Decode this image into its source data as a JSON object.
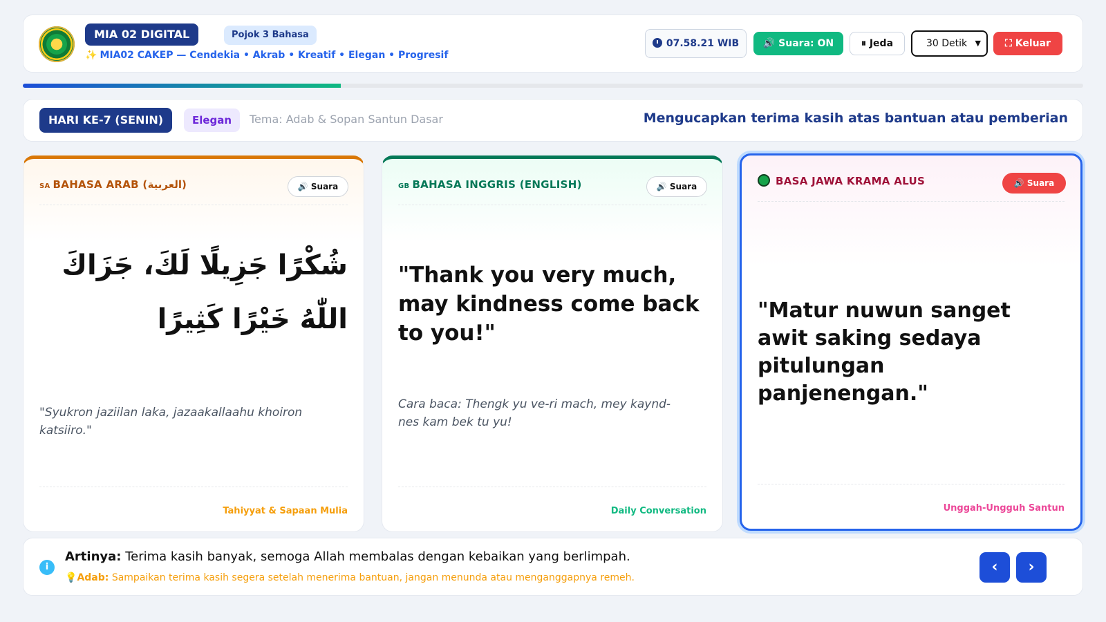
{
  "header": {
    "brand": "MIA 02 DIGITAL",
    "badge": "Pojok 3 Bahasa",
    "tagline": "MIA02 CAKEP — Cendekia • Akrab • Kreatif • Elegan • Progresif",
    "clock": "07.58.21 WIB",
    "sound_button": "🔊 Suara: ON",
    "pause_button": "⏸ Jeda",
    "interval_select": "30 Detik",
    "exit_button": "⛶ Keluar",
    "progress": 0.3
  },
  "topic": {
    "day": "HARI KE-7 (SENIN)",
    "value": "Elegan",
    "theme": "Tema: Adab & Sopan Santun Dasar",
    "headline": "Mengucapkan terima kasih atas bantuan atau pemberian"
  },
  "cards": {
    "arab": {
      "code": "SA",
      "title": "BAHASA ARAB (العربية)",
      "voice": "🔊 Suara",
      "phrase": "شُكْرًا جَزِيلًا لَكَ، جَزَاكَ اللّٰهُ خَيْرًا كَثِيرًا",
      "reading": "\"Syukron jaziilan laka, jazaakallaahu khoiron katsiiro.\"",
      "category": "Tahiyyat & Sapaan Mulia"
    },
    "english": {
      "code": "GB",
      "title": "BAHASA INGGRIS (ENGLISH)",
      "voice": "🔊 Suara",
      "phrase": "\"Thank you very much, may kindness come back to you!\"",
      "reading": "Cara baca: Thengk yu ve-ri mach, mey kaynd-nes kam bek tu yu!",
      "category": "Daily Conversation"
    },
    "jawa": {
      "title": "BASA JAWA KRAMA ALUS",
      "voice": "🔊 Suara",
      "phrase": "\"Matur nuwun sanget awit saking sedaya pitulungan panjenengan.\"",
      "category": "Unggah-Ungguh Santun"
    }
  },
  "footer": {
    "meaning_label": "Artinya:",
    "meaning": "Terima kasih banyak, semoga Allah membalas dengan kebaikan yang berlimpah.",
    "adab_label": "Adab:",
    "adab": "Sampaikan terima kasih segera setelah menerima bantuan, jangan menunda atau menganggapnya remeh."
  },
  "icons": {
    "logo": "school-emblem",
    "clock": "clock-icon",
    "prev": "chevron-left-icon",
    "next": "chevron-right-icon",
    "info": "info-icon",
    "bulb": "lightbulb-icon"
  }
}
